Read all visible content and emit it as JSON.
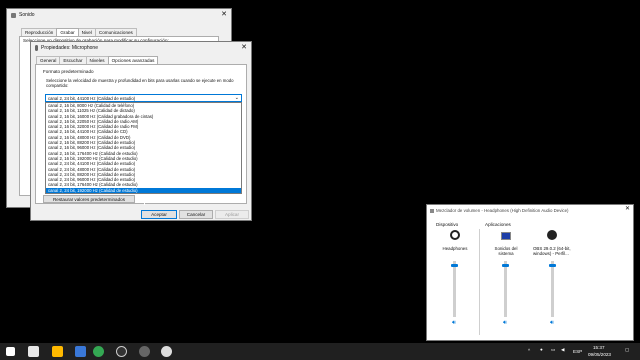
{
  "sound_window": {
    "title": "Sonido",
    "tabs": [
      "Reproducción",
      "Grabar",
      "Nivel",
      "Comunicaciones"
    ],
    "hint_text": "Seleccione un dispositivo de grabación para modificar su configuración:"
  },
  "props_window": {
    "title": "Propiedades: Microphone",
    "tabs": [
      "General",
      "Escuchar",
      "Niveles",
      "Opciones avanzadas"
    ],
    "section_title": "Formato predeterminado",
    "description": "Seleccione la velocidad de muestra y profundidad en bits para usarlas cuando se ejecute en modo compartido:",
    "dropdown_value": "canal 2, 24 bit, 44100 Hz (Calidad de estudio)",
    "options": [
      "canal 2, 16 bit, 8000 Hz (Calidad de teléfono)",
      "canal 2, 16 bit, 11025 Hz (Calidad de dictado)",
      "canal 2, 16 bit, 16000 Hz (Calidad grabadora de cintas)",
      "canal 2, 16 bit, 22050 Hz (Calidad de radio AM)",
      "canal 2, 16 bit, 32000 Hz (Calidad de radio FM)",
      "canal 2, 16 bit, 44100 Hz (Calidad de CD)",
      "canal 2, 16 bit, 48000 Hz (Calidad de DVD)",
      "canal 2, 16 bit, 88200 Hz (Calidad de estudio)",
      "canal 2, 16 bit, 96000 Hz (Calidad de estudio)",
      "canal 2, 16 bit, 176400 Hz (Calidad de estudio)",
      "canal 2, 16 bit, 192000 Hz (Calidad de estudio)",
      "canal 2, 24 bit, 44100 Hz (Calidad de estudio)",
      "canal 2, 24 bit, 48000 Hz (Calidad de estudio)",
      "canal 2, 24 bit, 88200 Hz (Calidad de estudio)",
      "canal 2, 24 bit, 96000 Hz (Calidad de estudio)",
      "canal 2, 24 bit, 176400 Hz (Calidad de estudio)",
      "canal 2, 24 bit, 192000 Hz (Calidad de estudio)"
    ],
    "restore_label": "Restaurar valores predeterminados",
    "ok_label": "Aceptar",
    "cancel_label": "Cancelar",
    "apply_label": "Aplicar"
  },
  "mixer": {
    "title": "Mezclador de volumen - Headphones (High Definition Audio Device)",
    "device_header": "Dispositivo",
    "apps_header": "Aplicaciones",
    "channels": [
      {
        "name": "Headphones",
        "level": 0.92
      },
      {
        "name": "Sonidos del sistema",
        "level": 0.92
      },
      {
        "name": "OBS 29.0.2 (64-bit, windows) - Perfil...",
        "level": 0.92
      }
    ]
  },
  "taskbar": {
    "language": "ESP",
    "time": "15:37",
    "date": "09/05/2023"
  },
  "colors": {
    "accent": "#0078d7",
    "taskbar": "#202020"
  }
}
